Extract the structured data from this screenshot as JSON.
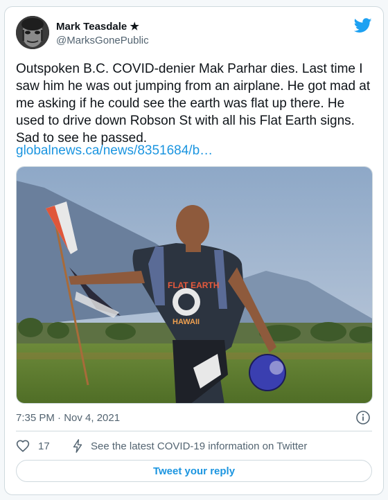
{
  "author": {
    "name": "Mark Teasdale ★",
    "handle": "@MarksGonePublic"
  },
  "tweet": {
    "text": "Outspoken B.C. COVID-denier Mak Parhar dies. Last time I saw him he was out jumping from an airplane. He got mad at me asking if he could see the earth was flat up there. He used to drive down Robson St with all his Flat Earth signs. Sad to see he passed.",
    "link": "globalnews.ca/news/8351684/b…"
  },
  "media": {
    "shirt_text_top": "FLAT EARTH",
    "shirt_text_bottom": "HAWAII"
  },
  "meta": {
    "timestamp": "7:35 PM · Nov 4, 2021"
  },
  "actions": {
    "like_count": "17",
    "covid_info": "See the latest COVID-19 information on Twitter",
    "reply_label": "Tweet your reply"
  },
  "icons": {
    "brand": "twitter-bird-icon",
    "info": "info-icon",
    "like": "heart-icon",
    "covid": "lightning-icon"
  },
  "colors": {
    "accent": "#1b95e0",
    "text": "#0f1419",
    "muted": "#536471",
    "border": "#cfd9de"
  }
}
